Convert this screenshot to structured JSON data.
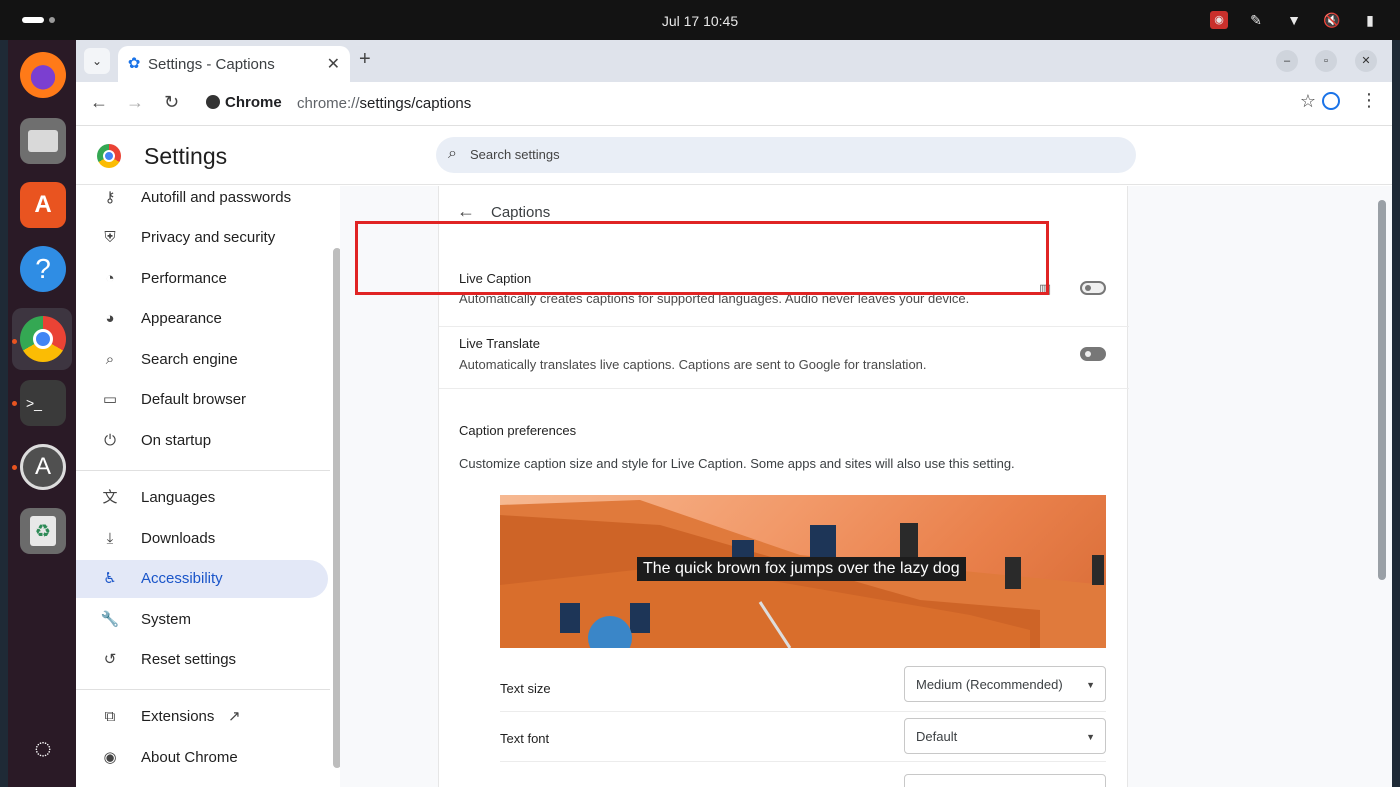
{
  "system_bar": {
    "clock": "Jul 17  10:45"
  },
  "dock": {
    "apps": [
      {
        "name": "Firefox",
        "icon": "firefox-icon"
      },
      {
        "name": "Files",
        "icon": "files-icon"
      },
      {
        "name": "App Center",
        "icon": "app-center-icon"
      },
      {
        "name": "Help",
        "icon": "help-icon"
      },
      {
        "name": "Chrome",
        "icon": "chrome-icon"
      },
      {
        "name": "Terminal",
        "icon": "terminal-icon"
      },
      {
        "name": "Software Updater",
        "icon": "updater-icon"
      },
      {
        "name": "Trash",
        "icon": "trash-icon"
      }
    ]
  },
  "browser": {
    "tab": {
      "title": "Settings - Captions"
    },
    "omnibox": {
      "chip": "Chrome",
      "url_host": "chrome://",
      "url_path": "settings/captions"
    }
  },
  "settings": {
    "title": "Settings",
    "search_placeholder": "Search settings",
    "sidebar": {
      "items": [
        {
          "label": "Autofill and passwords",
          "icon": "key-icon"
        },
        {
          "label": "Privacy and security",
          "icon": "shield-icon"
        },
        {
          "label": "Performance",
          "icon": "speedometer-icon"
        },
        {
          "label": "Appearance",
          "icon": "palette-icon"
        },
        {
          "label": "Search engine",
          "icon": "search-icon"
        },
        {
          "label": "Default browser",
          "icon": "browser-window-icon"
        },
        {
          "label": "On startup",
          "icon": "power-icon"
        },
        {
          "label": "Languages",
          "icon": "translate-icon"
        },
        {
          "label": "Downloads",
          "icon": "download-icon"
        },
        {
          "label": "Accessibility",
          "icon": "accessibility-icon",
          "active": true
        },
        {
          "label": "System",
          "icon": "wrench-icon"
        },
        {
          "label": "Reset settings",
          "icon": "reset-icon"
        },
        {
          "label": "Extensions",
          "icon": "extension-icon"
        },
        {
          "label": "About Chrome",
          "icon": "chrome-icon"
        }
      ]
    },
    "captions": {
      "page_title": "Captions",
      "live_caption": {
        "title": "Live Caption",
        "description": "Automatically creates captions for supported languages. Audio never leaves your device.",
        "enabled": false
      },
      "live_translate": {
        "title": "Live Translate",
        "description": "Automatically translates live captions. Captions are sent to Google for translation.",
        "enabled": false
      },
      "preferences_title": "Caption preferences",
      "preferences_desc": "Customize caption size and style for Live Caption. Some apps and sites will also use this setting.",
      "preview_caption": "The quick brown fox jumps over the lazy dog",
      "text_size": {
        "label": "Text size",
        "value": "Medium (Recommended)"
      },
      "text_font": {
        "label": "Text font",
        "value": "Default"
      }
    }
  },
  "colors": {
    "accent": "#1a73e8",
    "highlight_box": "#e02424",
    "active_nav": "#e3e8f7"
  }
}
